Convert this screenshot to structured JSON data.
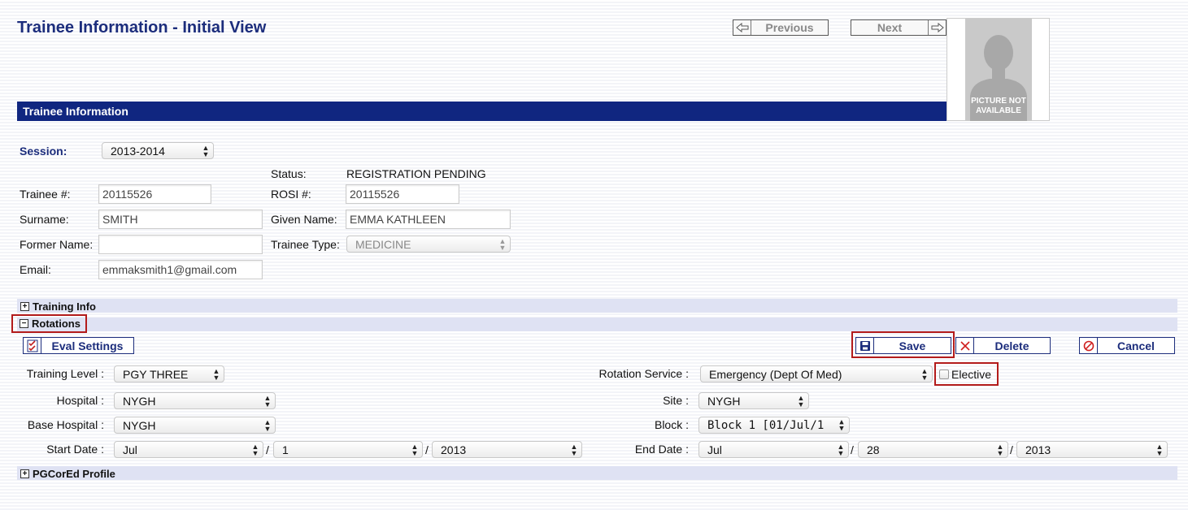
{
  "page_title": "Trainee Information - Initial View",
  "nav": {
    "previous_label": "Previous",
    "next_label": "Next"
  },
  "photo": {
    "caption_line1": "PICTURE NOT",
    "caption_line2": "AVAILABLE"
  },
  "section_header": "Trainee Information",
  "session": {
    "label": "Session:",
    "value": "2013-2014"
  },
  "status": {
    "label": "Status:",
    "value": "REGISTRATION PENDING"
  },
  "trainee_no": {
    "label": "Trainee #:",
    "value": "20115526"
  },
  "rosi_no": {
    "label": "ROSI #:",
    "value": "20115526"
  },
  "surname": {
    "label": "Surname:",
    "value": "SMITH"
  },
  "given_name": {
    "label": "Given Name:",
    "value": "EMMA KATHLEEN"
  },
  "former_name": {
    "label": "Former Name:",
    "value": ""
  },
  "trainee_type": {
    "label": "Trainee Type:",
    "value": "MEDICINE"
  },
  "email": {
    "label": "Email:",
    "value": "emmaksmith1@gmail.com"
  },
  "sections": {
    "training_info": "Training Info",
    "rotations": "Rotations",
    "pgcored_profile": "PGCorEd Profile"
  },
  "buttons": {
    "eval_settings": "Eval Settings",
    "save": "Save",
    "delete": "Delete",
    "cancel": "Cancel"
  },
  "rotation": {
    "training_level": {
      "label": "Training Level :",
      "value": "PGY THREE"
    },
    "rotation_service": {
      "label": "Rotation Service :",
      "value": "Emergency (Dept Of Med)"
    },
    "elective": {
      "label": "Elective",
      "checked": false
    },
    "hospital": {
      "label": "Hospital :",
      "value": "NYGH"
    },
    "site": {
      "label": "Site :",
      "value": "NYGH"
    },
    "base_hospital": {
      "label": "Base Hospital :",
      "value": "NYGH"
    },
    "block": {
      "label": "Block :",
      "value": "Block 1 [01/Jul/1"
    },
    "start_date": {
      "label": "Start Date :",
      "month": "Jul",
      "day": "1",
      "year": "2013"
    },
    "end_date": {
      "label": "End Date :",
      "month": "Jul",
      "day": "28",
      "year": "2013"
    },
    "date_separator": "/"
  },
  "colors": {
    "brand": "#102680",
    "title": "#1c2d7c",
    "section_bg": "#dfe2f3",
    "highlight": "#b31b1b"
  }
}
